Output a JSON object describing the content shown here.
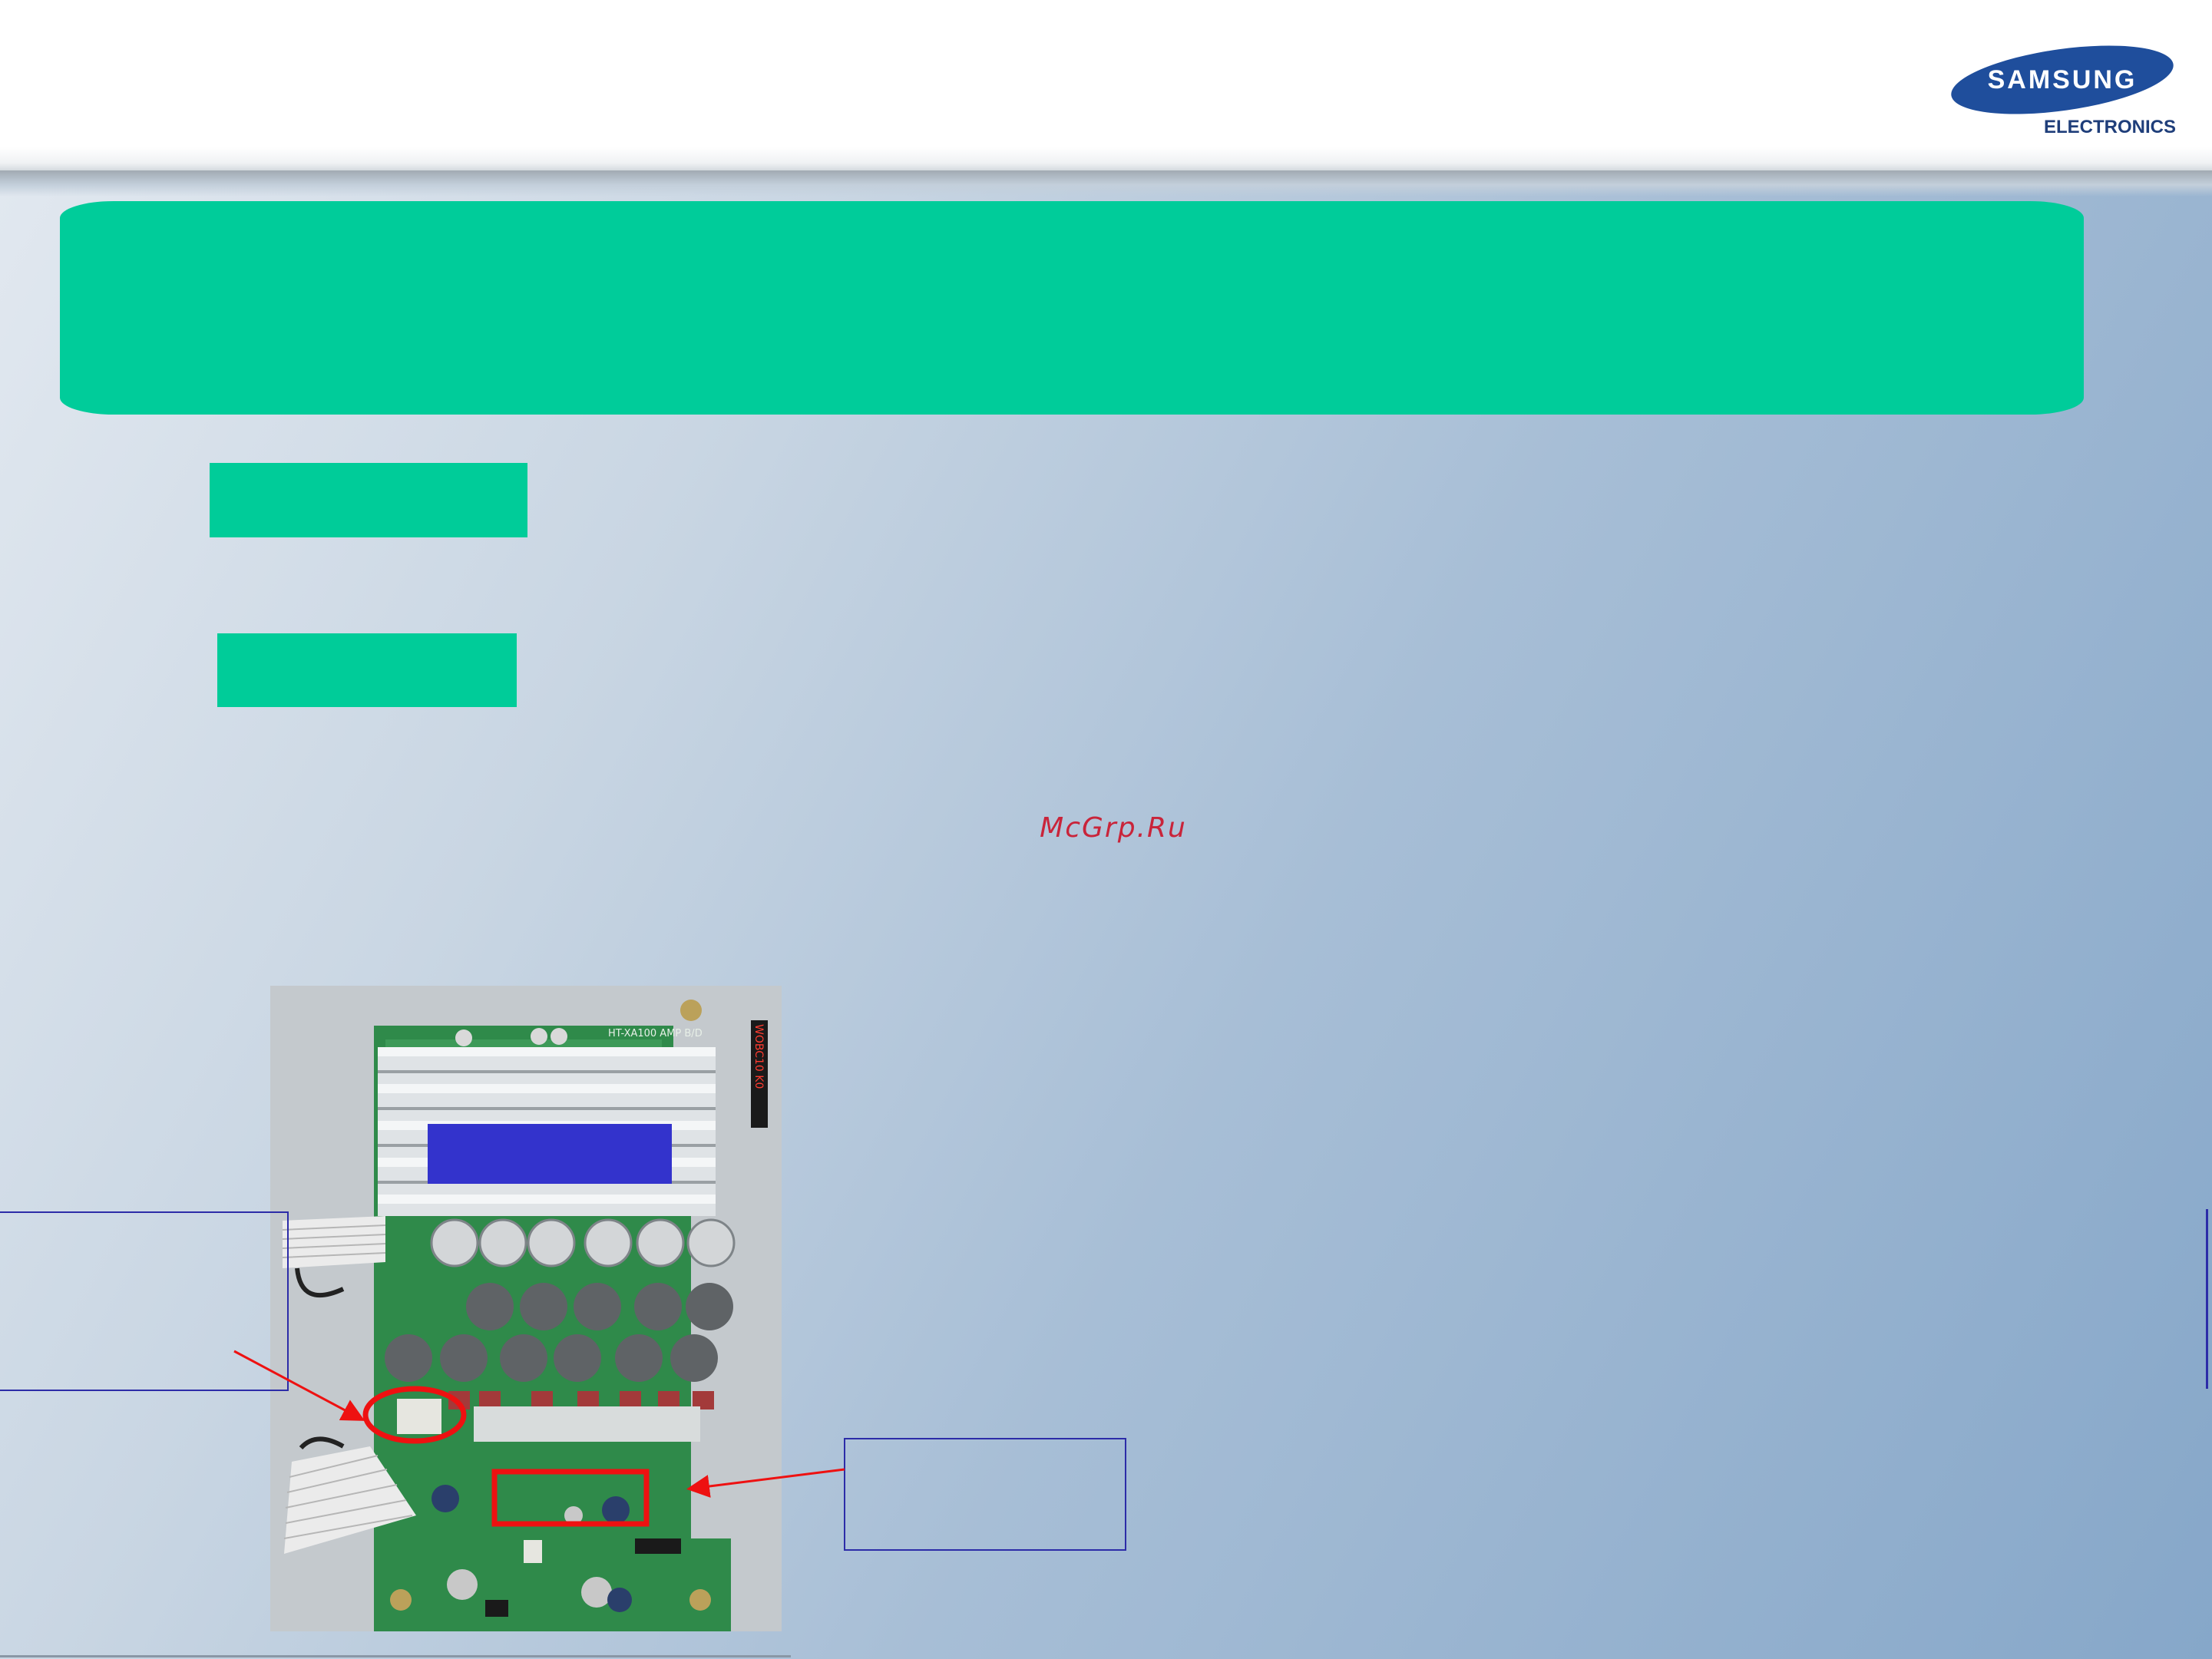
{
  "logo": {
    "brand": "SAMSUNG",
    "division": "ELECTRONICS",
    "brand_color": "#1f4e9c"
  },
  "watermark": {
    "text": "McGrp.Ru",
    "color": "#c9243a"
  },
  "board": {
    "silkscreen_model": "HT-XA100 AMP B/D",
    "sticker": "WOBC10 K0"
  },
  "colors": {
    "banner": "#00cc9a",
    "label": "#00cc99",
    "blue_label": "#3333cc",
    "highlight": "#ee1111",
    "callout_border": "#2c2ca8"
  }
}
